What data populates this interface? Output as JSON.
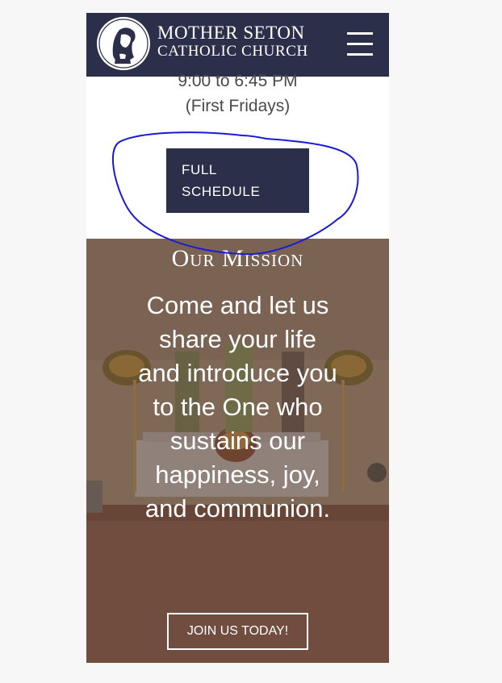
{
  "header": {
    "logo_line1": "MOTHER SETON",
    "logo_line2": "CATHOLIC CHURCH"
  },
  "schedule": {
    "time": "9:00 to 6:45 PM",
    "note": "(First Fridays)",
    "button_label": "FULL\nSCHEDULE"
  },
  "mission": {
    "heading": "Our Mission",
    "statement": "Come and let us share your life and introduce you to the One who sustains our happiness, joy, and communion.",
    "button_label": "JOIN US TODAY!"
  },
  "colors": {
    "navy": "#2c2f4a",
    "annotation_blue": "#1a1ad6"
  }
}
